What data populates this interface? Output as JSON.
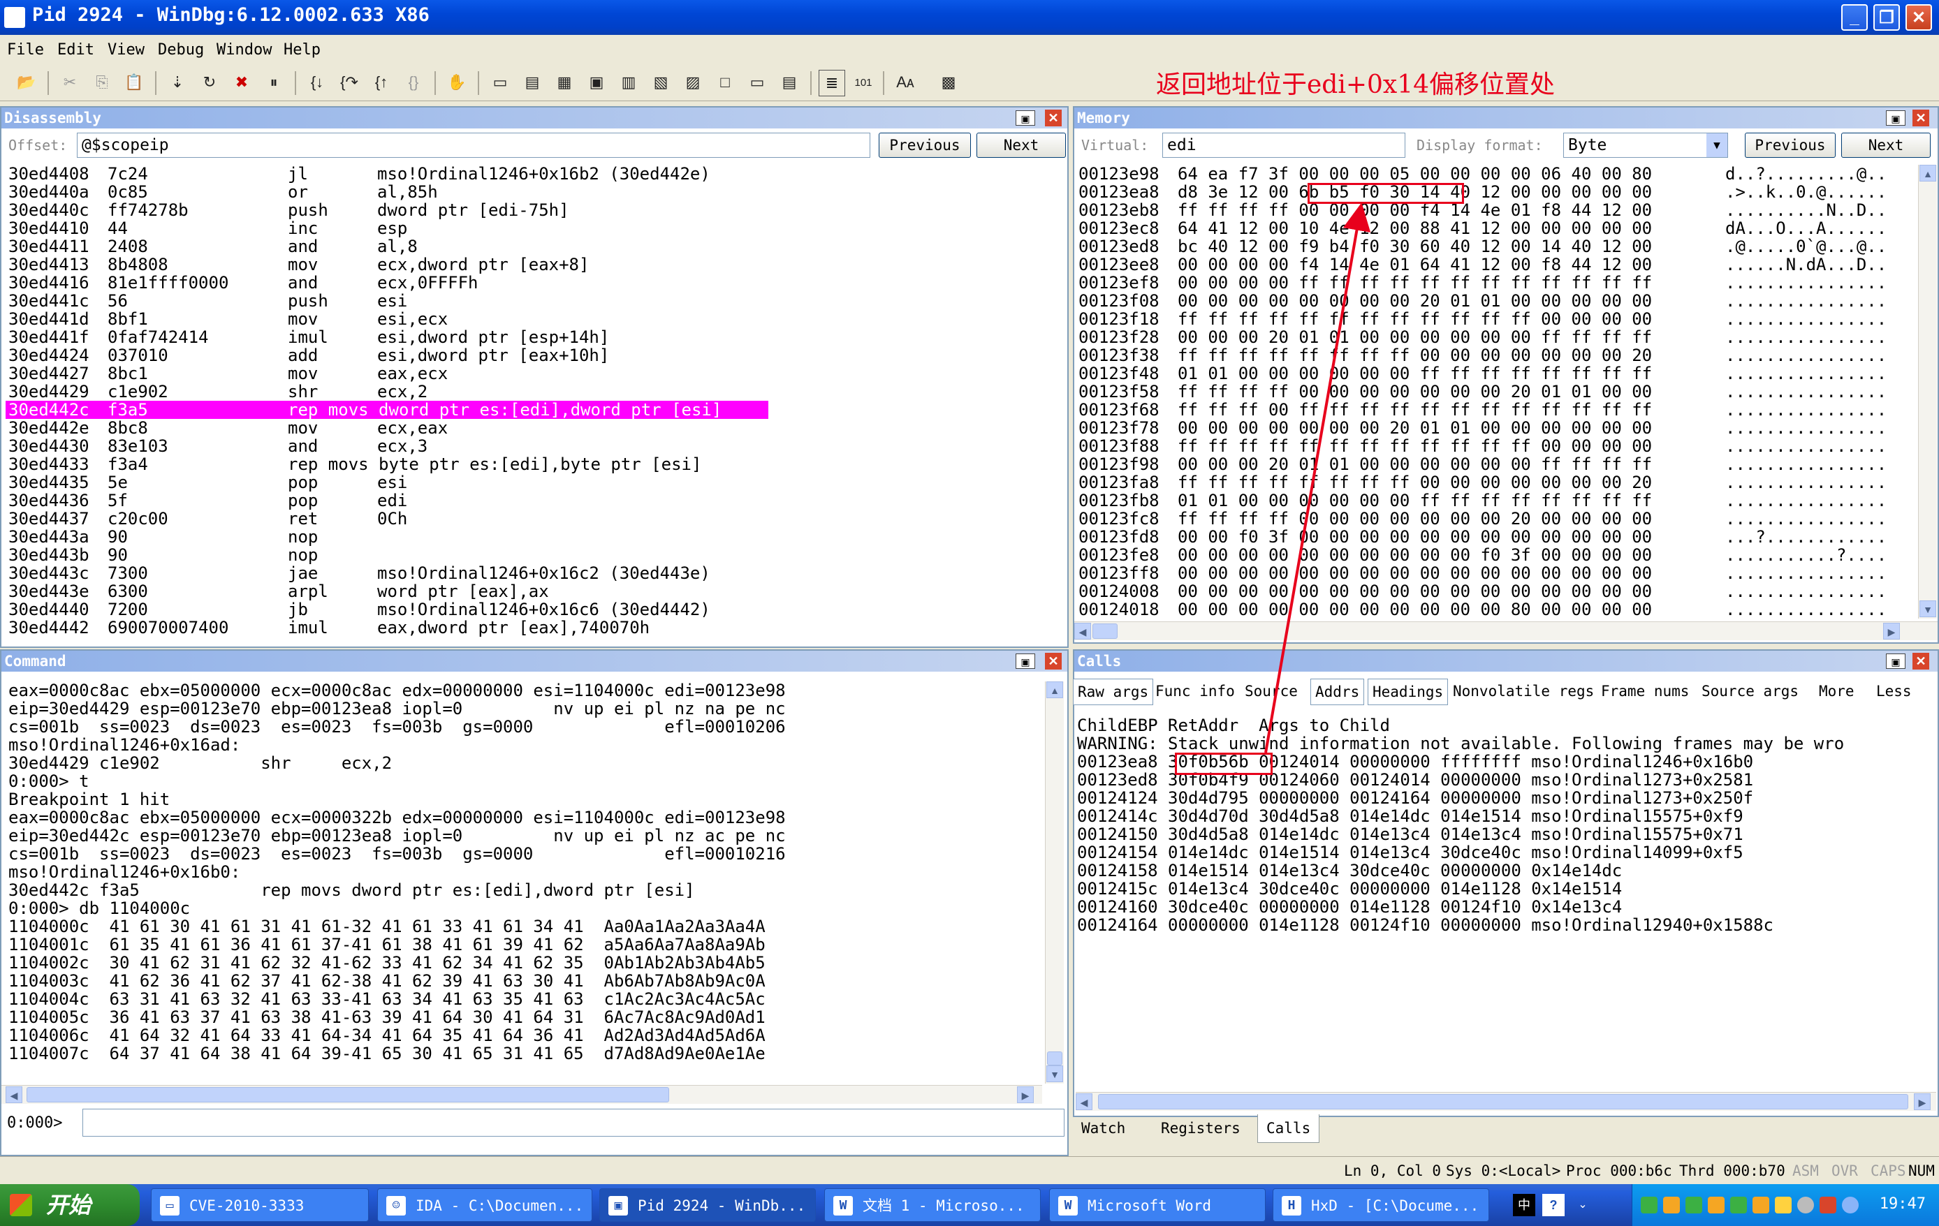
{
  "window": {
    "title": "Pid 2924 - WinDbg:6.12.0002.633 X86"
  },
  "menu": [
    "File",
    "Edit",
    "View",
    "Debug",
    "Window",
    "Help"
  ],
  "annotation": "返回地址位于edi+0x14偏移位置处",
  "disassembly": {
    "title": "Disassembly",
    "offset_label": "Offset:",
    "offset_value": "@$scopeip",
    "prev_label": "Previous",
    "next_label": "Next",
    "rows": [
      {
        "addr": "30ed4408",
        "bytes": "7c24",
        "op": "jl",
        "args": "mso!Ordinal1246+0x16b2 (30ed442e)"
      },
      {
        "addr": "30ed440a",
        "bytes": "0c85",
        "op": "or",
        "args": "al,85h"
      },
      {
        "addr": "30ed440c",
        "bytes": "ff74278b",
        "op": "push",
        "args": "dword ptr [edi-75h]"
      },
      {
        "addr": "30ed4410",
        "bytes": "44",
        "op": "inc",
        "args": "esp"
      },
      {
        "addr": "30ed4411",
        "bytes": "2408",
        "op": "and",
        "args": "al,8"
      },
      {
        "addr": "30ed4413",
        "bytes": "8b4808",
        "op": "mov",
        "args": "ecx,dword ptr [eax+8]"
      },
      {
        "addr": "30ed4416",
        "bytes": "81e1ffff0000",
        "op": "and",
        "args": "ecx,0FFFFh"
      },
      {
        "addr": "30ed441c",
        "bytes": "56",
        "op": "push",
        "args": "esi"
      },
      {
        "addr": "30ed441d",
        "bytes": "8bf1",
        "op": "mov",
        "args": "esi,ecx"
      },
      {
        "addr": "30ed441f",
        "bytes": "0faf742414",
        "op": "imul",
        "args": "esi,dword ptr [esp+14h]"
      },
      {
        "addr": "30ed4424",
        "bytes": "037010",
        "op": "add",
        "args": "esi,dword ptr [eax+10h]"
      },
      {
        "addr": "30ed4427",
        "bytes": "8bc1",
        "op": "mov",
        "args": "eax,ecx"
      },
      {
        "addr": "30ed4429",
        "bytes": "c1e902",
        "op": "shr",
        "args": "ecx,2"
      },
      {
        "addr": "30ed442c",
        "bytes": "f3a5",
        "op": "rep movs dword ptr es:[edi],dword ptr [esi]",
        "args": "",
        "highlight": true
      },
      {
        "addr": "30ed442e",
        "bytes": "8bc8",
        "op": "mov",
        "args": "ecx,eax"
      },
      {
        "addr": "30ed4430",
        "bytes": "83e103",
        "op": "and",
        "args": "ecx,3"
      },
      {
        "addr": "30ed4433",
        "bytes": "f3a4",
        "op": "rep movs byte ptr es:[edi],byte ptr [esi]",
        "args": ""
      },
      {
        "addr": "30ed4435",
        "bytes": "5e",
        "op": "pop",
        "args": "esi"
      },
      {
        "addr": "30ed4436",
        "bytes": "5f",
        "op": "pop",
        "args": "edi"
      },
      {
        "addr": "30ed4437",
        "bytes": "c20c00",
        "op": "ret",
        "args": "0Ch"
      },
      {
        "addr": "30ed443a",
        "bytes": "90",
        "op": "nop",
        "args": ""
      },
      {
        "addr": "30ed443b",
        "bytes": "90",
        "op": "nop",
        "args": ""
      },
      {
        "addr": "30ed443c",
        "bytes": "7300",
        "op": "jae",
        "args": "mso!Ordinal1246+0x16c2 (30ed443e)"
      },
      {
        "addr": "30ed443e",
        "bytes": "6300",
        "op": "arpl",
        "args": "word ptr [eax],ax"
      },
      {
        "addr": "30ed4440",
        "bytes": "7200",
        "op": "jb",
        "args": "mso!Ordinal1246+0x16c6 (30ed4442)"
      },
      {
        "addr": "30ed4442",
        "bytes": "690070007400",
        "op": "imul",
        "args": "eax,dword ptr [eax],740070h"
      }
    ]
  },
  "memory": {
    "title": "Memory",
    "virtual_label": "Virtual:",
    "virtual_value": "edi",
    "format_label": "Display format:",
    "format_value": "Byte",
    "prev_label": "Previous",
    "next_label": "Next",
    "rows": [
      {
        "addr": "00123e98",
        "hex": "64 ea f7 3f 00 00 00 05 00 00 00 00 06 40 00 80",
        "ascii": "d..?.........@.."
      },
      {
        "addr": "00123ea8",
        "hex": "d8 3e 12 00 6b b5 f0 30 14 40 12 00 00 00 00 00",
        "ascii": ".>..k..0.@......"
      },
      {
        "addr": "00123eb8",
        "hex": "ff ff ff ff 00 00 00 00 f4 14 4e 01 f8 44 12 00",
        "ascii": "..........N..D.."
      },
      {
        "addr": "00123ec8",
        "hex": "64 41 12 00 10 4e 12 00 88 41 12 00 00 00 00 00",
        "ascii": "dA...O...A......"
      },
      {
        "addr": "00123ed8",
        "hex": "bc 40 12 00 f9 b4 f0 30 60 40 12 00 14 40 12 00",
        "ascii": ".@.....0`@...@.."
      },
      {
        "addr": "00123ee8",
        "hex": "00 00 00 00 f4 14 4e 01 64 41 12 00 f8 44 12 00",
        "ascii": "......N.dA...D.."
      },
      {
        "addr": "00123ef8",
        "hex": "00 00 00 00 ff ff ff ff ff ff ff ff ff ff ff ff",
        "ascii": "................"
      },
      {
        "addr": "00123f08",
        "hex": "00 00 00 00 00 00 00 00 20 01 01 00 00 00 00 00",
        "ascii": "................"
      },
      {
        "addr": "00123f18",
        "hex": "ff ff ff ff ff ff ff ff ff ff ff ff 00 00 00 00",
        "ascii": "................"
      },
      {
        "addr": "00123f28",
        "hex": "00 00 00 20 01 01 00 00 00 00 00 00 ff ff ff ff",
        "ascii": "................"
      },
      {
        "addr": "00123f38",
        "hex": "ff ff ff ff ff ff ff ff 00 00 00 00 00 00 00 20",
        "ascii": "................"
      },
      {
        "addr": "00123f48",
        "hex": "01 01 00 00 00 00 00 00 ff ff ff ff ff ff ff ff",
        "ascii": "................"
      },
      {
        "addr": "00123f58",
        "hex": "ff ff ff ff 00 00 00 00 00 00 00 20 01 01 00 00",
        "ascii": "................"
      },
      {
        "addr": "00123f68",
        "hex": "ff ff ff 00 ff ff ff ff ff ff ff ff ff ff ff ff",
        "ascii": "................"
      },
      {
        "addr": "00123f78",
        "hex": "00 00 00 00 00 00 00 20 01 01 00 00 00 00 00 00",
        "ascii": "................"
      },
      {
        "addr": "00123f88",
        "hex": "ff ff ff ff ff ff ff ff ff ff ff ff 00 00 00 00",
        "ascii": "................"
      },
      {
        "addr": "00123f98",
        "hex": "00 00 00 20 01 01 00 00 00 00 00 00 ff ff ff ff",
        "ascii": "................"
      },
      {
        "addr": "00123fa8",
        "hex": "ff ff ff ff ff ff ff ff 00 00 00 00 00 00 00 20",
        "ascii": "................"
      },
      {
        "addr": "00123fb8",
        "hex": "01 01 00 00 00 00 00 00 ff ff ff ff ff ff ff ff",
        "ascii": "................"
      },
      {
        "addr": "00123fc8",
        "hex": "ff ff ff ff 00 00 00 00 00 00 00 20 00 00 00 00",
        "ascii": "................"
      },
      {
        "addr": "00123fd8",
        "hex": "00 00 f0 3f 00 00 00 00 00 00 00 00 00 00 00 00",
        "ascii": "...?............"
      },
      {
        "addr": "00123fe8",
        "hex": "00 00 00 00 00 00 00 00 00 00 f0 3f 00 00 00 00",
        "ascii": "...........?...."
      },
      {
        "addr": "00123ff8",
        "hex": "00 00 00 00 00 00 00 00 00 00 00 00 00 00 00 00",
        "ascii": "................"
      },
      {
        "addr": "00124008",
        "hex": "00 00 00 00 00 00 00 00 00 00 00 00 00 00 00 00",
        "ascii": "................"
      },
      {
        "addr": "00124018",
        "hex": "00 00 00 00 00 00 00 00 00 00 00 80 00 00 00 00",
        "ascii": "................"
      }
    ]
  },
  "command": {
    "title": "Command",
    "prompt": "0:000>",
    "lines": [
      "eax=0000c8ac ebx=05000000 ecx=0000c8ac edx=00000000 esi=1104000c edi=00123e98",
      "eip=30ed4429 esp=00123e70 ebp=00123ea8 iopl=0         nv up ei pl nz na pe nc",
      "cs=001b  ss=0023  ds=0023  es=0023  fs=003b  gs=0000             efl=00010206",
      "mso!Ordinal1246+0x16ad:",
      "30ed4429 c1e902          shr     ecx,2",
      "0:000> t",
      "Breakpoint 1 hit",
      "eax=0000c8ac ebx=05000000 ecx=0000322b edx=00000000 esi=1104000c edi=00123e98",
      "eip=30ed442c esp=00123e70 ebp=00123ea8 iopl=0         nv up ei pl nz ac pe nc",
      "cs=001b  ss=0023  ds=0023  es=0023  fs=003b  gs=0000             efl=00010216",
      "mso!Ordinal1246+0x16b0:",
      "30ed442c f3a5            rep movs dword ptr es:[edi],dword ptr [esi]",
      "0:000> db 1104000c",
      "1104000c  41 61 30 41 61 31 41 61-32 41 61 33 41 61 34 41  Aa0Aa1Aa2Aa3Aa4A",
      "1104001c  61 35 41 61 36 41 61 37-41 61 38 41 61 39 41 62  a5Aa6Aa7Aa8Aa9Ab",
      "1104002c  30 41 62 31 41 62 32 41-62 33 41 62 34 41 62 35  0Ab1Ab2Ab3Ab4Ab5",
      "1104003c  41 62 36 41 62 37 41 62-38 41 62 39 41 63 30 41  Ab6Ab7Ab8Ab9Ac0A",
      "1104004c  63 31 41 63 32 41 63 33-41 63 34 41 63 35 41 63  c1Ac2Ac3Ac4Ac5Ac",
      "1104005c  36 41 63 37 41 63 38 41-63 39 41 64 30 41 64 31  6Ac7Ac8Ac9Ad0Ad1",
      "1104006c  41 64 32 41 64 33 41 64-34 41 64 35 41 64 36 41  Ad2Ad3Ad4Ad5Ad6A",
      "1104007c  64 37 41 64 38 41 64 39-41 65 30 41 65 31 41 65  d7Ad8Ad9Ae0Ae1Ae"
    ]
  },
  "calls": {
    "title": "Calls",
    "tabs": [
      "Raw args",
      "Func info",
      "Source",
      "Addrs",
      "Headings",
      "Nonvolatile regs",
      "Frame nums",
      "Source args",
      "More",
      "Less"
    ],
    "lines": [
      "ChildEBP RetAddr  Args to Child",
      "WARNING: Stack unwind information not available. Following frames may be wro",
      "00123ea8 30f0b56b 00124014 00000000 ffffffff mso!Ordinal1246+0x16b0",
      "00123ed8 30f0b4f9 00124060 00124014 00000000 mso!Ordinal1273+0x2581",
      "00124124 30d4d795 00000000 00124164 00000000 mso!Ordinal1273+0x250f",
      "0012414c 30d4d70d 30d4d5a8 014e14dc 014e1514 mso!Ordinal15575+0xf9",
      "00124150 30d4d5a8 014e14dc 014e13c4 014e13c4 mso!Ordinal15575+0x71",
      "00124154 014e14dc 014e1514 014e13c4 30dce40c mso!Ordinal14099+0xf5",
      "00124158 014e1514 014e13c4 30dce40c 00000000 0x14e14dc",
      "0012415c 014e13c4 30dce40c 00000000 014e1128 0x14e1514",
      "00124160 30dce40c 00000000 014e1128 00124f10 0x14e13c4",
      "00124164 00000000 014e1128 00124f10 00000000 mso!Ordinal12940+0x1588c"
    ],
    "bottom_tabs": [
      "Watch",
      "Registers",
      "Calls"
    ]
  },
  "statusbar": {
    "ln": "Ln 0, Col 0",
    "sys": "Sys 0:<Local>",
    "proc": "Proc 000:b6c",
    "thrd": "Thrd 000:b70",
    "asm": "ASM",
    "ovr": "OVR",
    "caps": "CAPS",
    "num": "NUM"
  },
  "taskbar": {
    "start": "开始",
    "tasks": [
      {
        "label": "CVE-2010-3333",
        "icon": "folder-icon"
      },
      {
        "label": "IDA - C:\\Documen...",
        "icon": "ida-icon"
      },
      {
        "label": "Pid 2924 - WinDb...",
        "icon": "windbg-icon"
      },
      {
        "label": "文档 1 - Microso...",
        "icon": "word-doc-icon"
      },
      {
        "label": "Microsoft Word",
        "icon": "word-icon"
      },
      {
        "label": "HxD - [C:\\Docume...",
        "icon": "hxd-icon"
      }
    ],
    "clock": "19:47"
  }
}
